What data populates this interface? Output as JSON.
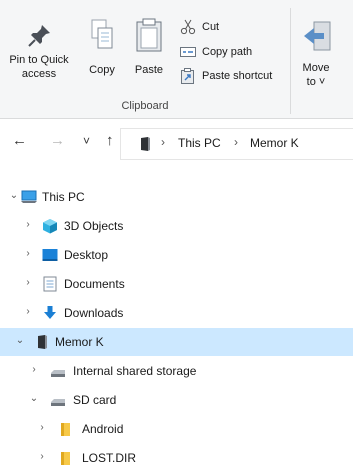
{
  "ribbon": {
    "pin_label_line1": "Pin to Quick",
    "pin_label_line2": "access",
    "copy_label": "Copy",
    "paste_label": "Paste",
    "cut_label": "Cut",
    "copy_path_label": "Copy path",
    "paste_shortcut_label": "Paste shortcut",
    "move_label_line1": "Move",
    "move_label_line2": "to ˅",
    "group_label": "Clipboard"
  },
  "address": {
    "back_glyph": "←",
    "forward_glyph": "→",
    "recent_glyph": "˅",
    "up_glyph": "↑",
    "crumbs": [
      "This PC",
      "Memor K"
    ],
    "separator": "›"
  },
  "tree": {
    "items": [
      {
        "label": "This PC",
        "icon": "computer-icon",
        "expanded": true
      },
      {
        "label": "3D Objects",
        "icon": "3d-objects-icon",
        "expanded": false
      },
      {
        "label": "Desktop",
        "icon": "desktop-icon",
        "expanded": false
      },
      {
        "label": "Documents",
        "icon": "documents-icon",
        "expanded": false
      },
      {
        "label": "Downloads",
        "icon": "downloads-icon",
        "expanded": false
      },
      {
        "label": "Memor K",
        "icon": "phone-device-icon",
        "expanded": true,
        "selected": true
      },
      {
        "label": "Internal shared storage",
        "icon": "storage-drive-icon",
        "expanded": false
      },
      {
        "label": "SD card",
        "icon": "sd-card-drive-icon",
        "expanded": true
      },
      {
        "label": "Android",
        "icon": "folder-icon",
        "expanded": false
      },
      {
        "label": "LOST.DIR",
        "icon": "folder-icon",
        "expanded": false
      }
    ]
  },
  "colors": {
    "selection": "#cce8ff",
    "folder": "#f7c948",
    "accent_blue": "#1a7fd4"
  }
}
